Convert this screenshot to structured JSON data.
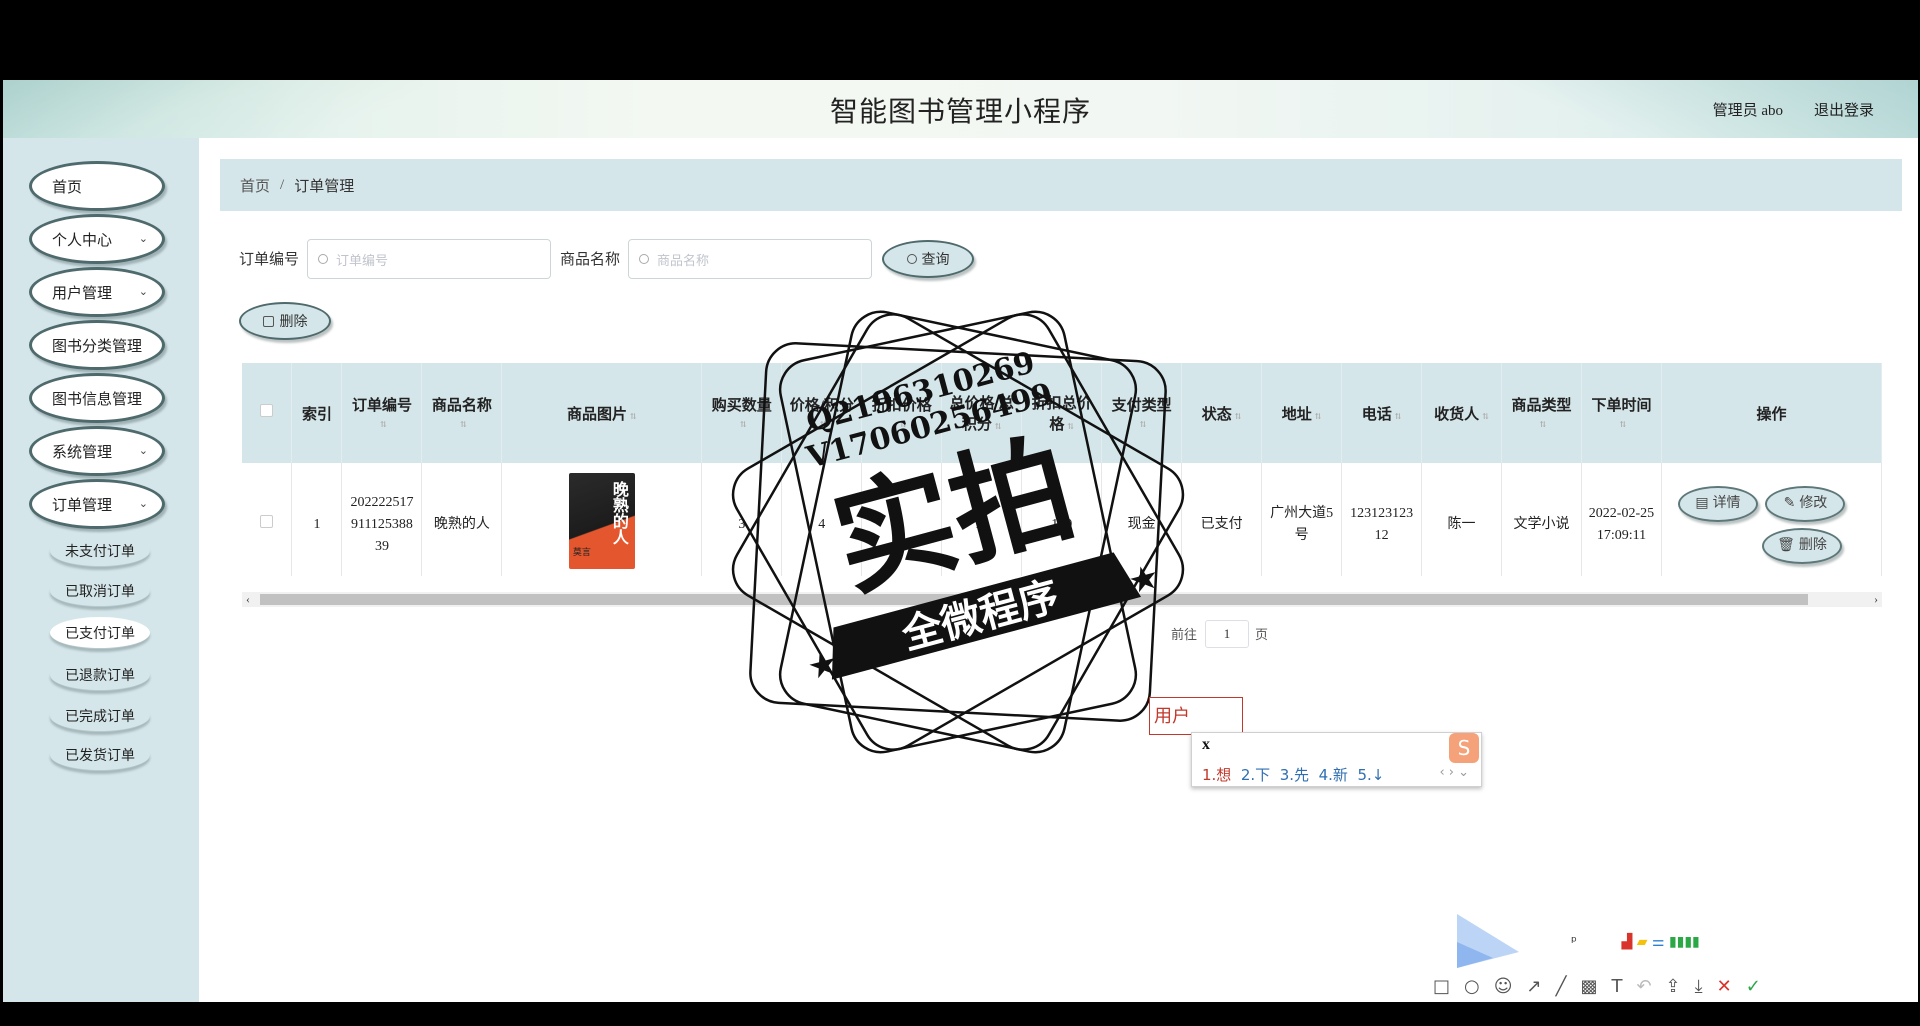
{
  "app": {
    "title": "智能图书管理小程序",
    "admin": "管理员 abo",
    "logout": "退出登录"
  },
  "sidebar": {
    "items": [
      {
        "label": "首页",
        "has_children": false
      },
      {
        "label": "个人中心",
        "has_children": true
      },
      {
        "label": "用户管理",
        "has_children": true
      },
      {
        "label": "图书分类管理",
        "has_children": true
      },
      {
        "label": "图书信息管理",
        "has_children": true
      },
      {
        "label": "系统管理",
        "has_children": true
      },
      {
        "label": "订单管理",
        "has_children": true
      }
    ],
    "submenu": [
      "未支付订单",
      "已取消订单",
      "已支付订单",
      "已退款订单",
      "已完成订单",
      "已发货订单"
    ],
    "active_submenu": "已支付订单"
  },
  "breadcrumb": {
    "home": "首页",
    "sep": "/",
    "current": "订单管理"
  },
  "search": {
    "order_no_label": "订单编号",
    "order_no_placeholder": "订单编号",
    "product_label": "商品名称",
    "product_placeholder": "商品名称",
    "query_button": "查询"
  },
  "toolbar": {
    "delete_button": "删除"
  },
  "table": {
    "headers": [
      "索引",
      "订单编号",
      "商品名称",
      "商品图片",
      "购买数量",
      "价格/积分",
      "折扣价格",
      "总价格/总积分",
      "折扣总价格",
      "支付类型",
      "状态",
      "地址",
      "电话",
      "收货人",
      "商品类型",
      "下单时间",
      "操作"
    ],
    "rows": [
      {
        "index": "1",
        "order_no": "20222251791112538839",
        "product": "晚熟的人",
        "cover_title": "晚熟的人",
        "cover_author": "莫言",
        "qty": "3",
        "price": "4",
        "discount_price": "",
        "total": "12",
        "discount_total": "120",
        "pay_type": "现金",
        "status": "已支付",
        "address": "广州大道5号",
        "phone": "12312312312",
        "receiver": "陈一",
        "category": "文学小说",
        "time": "2022-02-25 17:09:11"
      }
    ],
    "row_actions": [
      "详情",
      "修改",
      "删除"
    ]
  },
  "pager": {
    "total": "共 1 条",
    "goto": "前往",
    "page": "1",
    "page_unit": "页"
  },
  "watermark": {
    "line1": "Q2196310269",
    "line2": "V17060256499",
    "main": "实拍",
    "banner": "全微程序"
  },
  "ime": {
    "composition": "x",
    "candidates": [
      "1.想",
      "2.下",
      "3.先",
      "4.新",
      "5.↓"
    ],
    "field_text": "用户"
  }
}
